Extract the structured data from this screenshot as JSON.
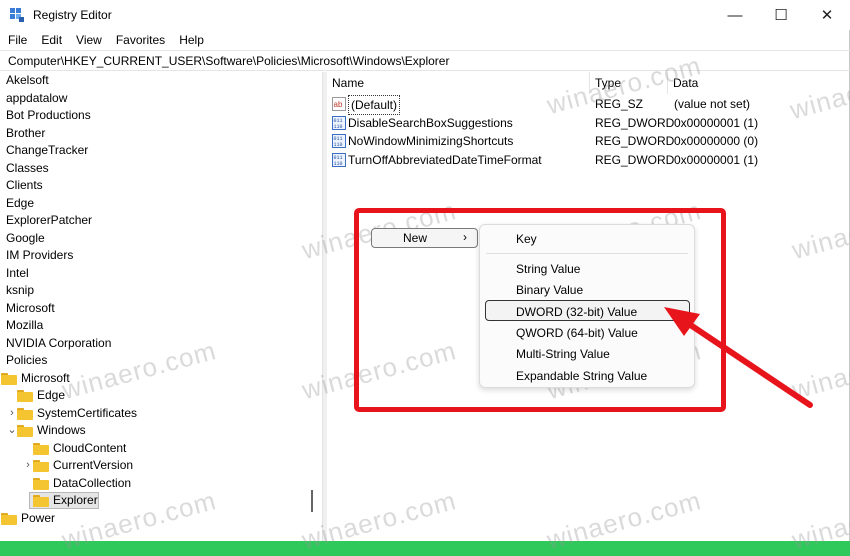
{
  "window": {
    "title": "Registry Editor",
    "minimize": "—",
    "maximize": "☐",
    "close": "✕"
  },
  "menu": [
    "File",
    "Edit",
    "View",
    "Favorites",
    "Help"
  ],
  "address": "Computer\\HKEY_CURRENT_USER\\Software\\Policies\\Microsoft\\Windows\\Explorer",
  "tree": [
    {
      "label": "Akelsoft",
      "indent": 0,
      "folder": false,
      "chevron": ""
    },
    {
      "label": "appdatalow",
      "indent": 0,
      "folder": false,
      "chevron": ""
    },
    {
      "label": "Bot Productions",
      "indent": 0,
      "folder": false,
      "chevron": ""
    },
    {
      "label": "Brother",
      "indent": 0,
      "folder": false,
      "chevron": ""
    },
    {
      "label": "ChangeTracker",
      "indent": 0,
      "folder": false,
      "chevron": ""
    },
    {
      "label": "Classes",
      "indent": 0,
      "folder": false,
      "chevron": ""
    },
    {
      "label": "Clients",
      "indent": 0,
      "folder": false,
      "chevron": ""
    },
    {
      "label": "Edge",
      "indent": 0,
      "folder": false,
      "chevron": ""
    },
    {
      "label": "ExplorerPatcher",
      "indent": 0,
      "folder": false,
      "chevron": ""
    },
    {
      "label": "Google",
      "indent": 0,
      "folder": false,
      "chevron": ""
    },
    {
      "label": "IM Providers",
      "indent": 0,
      "folder": false,
      "chevron": ""
    },
    {
      "label": "Intel",
      "indent": 0,
      "folder": false,
      "chevron": ""
    },
    {
      "label": "ksnip",
      "indent": 0,
      "folder": false,
      "chevron": ""
    },
    {
      "label": "Microsoft",
      "indent": 0,
      "folder": false,
      "chevron": ""
    },
    {
      "label": "Mozilla",
      "indent": 0,
      "folder": false,
      "chevron": ""
    },
    {
      "label": "NVIDIA Corporation",
      "indent": 0,
      "folder": false,
      "chevron": ""
    },
    {
      "label": "Policies",
      "indent": 0,
      "folder": false,
      "chevron": ""
    },
    {
      "label": "Microsoft",
      "indent": 1,
      "folder": true,
      "chevron": "⌄"
    },
    {
      "label": "Edge",
      "indent": 2,
      "folder": true,
      "chevron": ""
    },
    {
      "label": "SystemCertificates",
      "indent": 2,
      "folder": true,
      "chevron": "›"
    },
    {
      "label": "Windows",
      "indent": 2,
      "folder": true,
      "chevron": "⌄"
    },
    {
      "label": "CloudContent",
      "indent": 3,
      "folder": true,
      "chevron": ""
    },
    {
      "label": "CurrentVersion",
      "indent": 3,
      "folder": true,
      "chevron": "›"
    },
    {
      "label": "DataCollection",
      "indent": 3,
      "folder": true,
      "chevron": ""
    },
    {
      "label": "Explorer",
      "indent": 3,
      "folder": true,
      "chevron": "",
      "selected": true
    },
    {
      "label": "Power",
      "indent": 1,
      "folder": true,
      "chevron": ""
    }
  ],
  "columns": {
    "name": "Name",
    "type": "Type",
    "data": "Data"
  },
  "values": [
    {
      "name": "(Default)",
      "type": "REG_SZ",
      "data": "(value not set)",
      "icon": "string-value-icon"
    },
    {
      "name": "DisableSearchBoxSuggestions",
      "type": "REG_DWORD",
      "data": "0x00000001 (1)",
      "icon": "binary-value-icon"
    },
    {
      "name": "NoWindowMinimizingShortcuts",
      "type": "REG_DWORD",
      "data": "0x00000000 (0)",
      "icon": "binary-value-icon"
    },
    {
      "name": "TurnOffAbbreviatedDateTimeFormat",
      "type": "REG_DWORD",
      "data": "0x00000001 (1)",
      "icon": "binary-value-icon"
    }
  ],
  "context_menu": {
    "new_label": "New",
    "new_arrow": "›",
    "submenu": [
      "Key",
      "String Value",
      "Binary Value",
      "DWORD (32-bit) Value",
      "QWORD (64-bit) Value",
      "Multi-String Value",
      "Expandable String Value"
    ],
    "highlighted": "DWORD (32-bit) Value"
  },
  "watermark": "winaero.com",
  "colors": {
    "accent_red": "#e8141b",
    "folder_yellow": "#f5c431",
    "background_green": "#2fc95b"
  }
}
